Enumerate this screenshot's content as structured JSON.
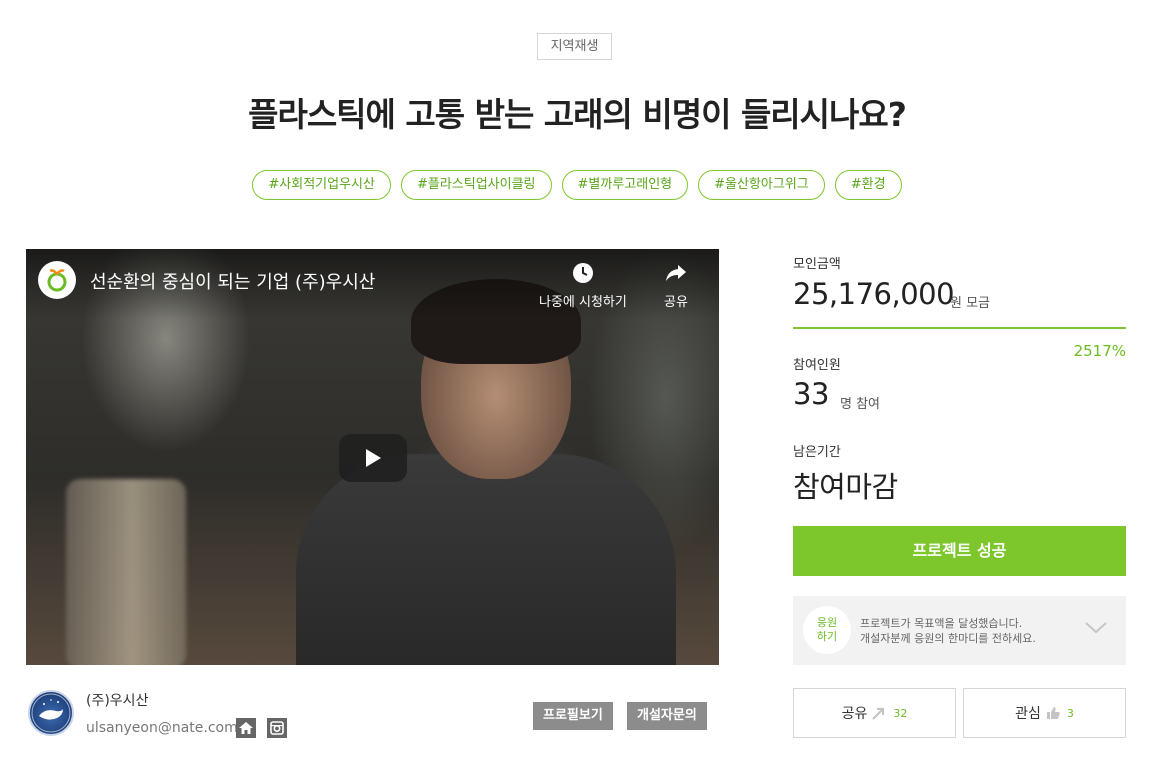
{
  "category": "지역재생",
  "title": "플라스틱에 고통 받는 고래의 비명이 들리시나요?",
  "tags": [
    "#사회적기업우시산",
    "#플라스틱업사이클링",
    "#별까루고래인형",
    "#울산항아그위그",
    "#환경"
  ],
  "video": {
    "title": "선순환의 중심이 되는 기업 (주)우시산",
    "watch_later": "나중에 시청하기",
    "share": "공유"
  },
  "creator": {
    "name": "(주)우시산",
    "email": "ulsanyeon@nate.com",
    "profile_button": "프로필보기",
    "contact_button": "개설자문의"
  },
  "stats": {
    "raised_label": "모인금액",
    "raised_amount": "25,176,000",
    "raised_unit": "원 모금",
    "percent": "2517%",
    "progress_fraction": 1.0,
    "participants_label": "참여인원",
    "participants": "33",
    "participants_unit": "명 참여",
    "remaining_label": "남은기간",
    "remaining_value": "참여마감"
  },
  "success_button": "프로젝트 성공",
  "cheer": {
    "circle_line1": "응원",
    "circle_line2": "하기",
    "text_line1": "프로젝트가 목표액을 달성했습니다.",
    "text_line2": "개설자분께 응원의 한마디를 전하세요."
  },
  "share_button": {
    "label": "공유",
    "count": "32"
  },
  "like_button": {
    "label": "관심",
    "count": "3"
  },
  "colors": {
    "accent": "#7dc72d",
    "gray_button": "#8c8c8c"
  }
}
